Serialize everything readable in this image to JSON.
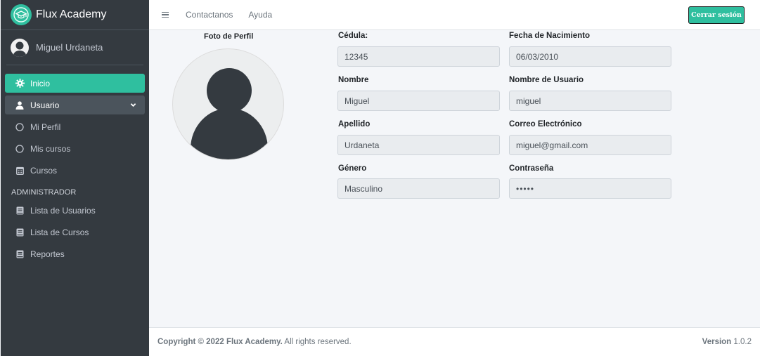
{
  "brand": {
    "name": "Flux Academy",
    "logo_icon": "graduation-cap-icon",
    "accent": "#2fbf9f"
  },
  "user": {
    "name": "Miguel Urdaneta"
  },
  "sidebar": {
    "items": [
      {
        "label": "Inicio",
        "icon": "gear-icon"
      },
      {
        "label": "Usuario",
        "icon": "user-icon"
      },
      {
        "label": "Mi Perfil",
        "icon": "circle-icon"
      },
      {
        "label": "Mis cursos",
        "icon": "circle-icon"
      },
      {
        "label": "Cursos",
        "icon": "calendar-icon"
      }
    ],
    "admin_header": "ADMINISTRADOR",
    "admin_items": [
      {
        "label": "Lista de Usuarios",
        "icon": "book-icon"
      },
      {
        "label": "Lista de Cursos",
        "icon": "book-icon"
      },
      {
        "label": "Reportes",
        "icon": "book-icon"
      }
    ]
  },
  "topbar": {
    "links": [
      "Contactanos",
      "Ayuda"
    ],
    "logout_label": "Cerrar sesión"
  },
  "profile": {
    "photo_label": "Foto de Perfil",
    "fields": {
      "cedula": {
        "label": "Cédula:",
        "value": "12345"
      },
      "fecha": {
        "label": "Fecha de Nacimiento",
        "value": "06/03/2010"
      },
      "nombre": {
        "label": "Nombre",
        "value": "Miguel"
      },
      "usuario": {
        "label": "Nombre de Usuario",
        "value": "miguel"
      },
      "apellido": {
        "label": "Apellido",
        "value": "Urdaneta"
      },
      "correo": {
        "label": "Correo Electrónico",
        "value": "miguel@gmail.com"
      },
      "genero": {
        "label": "Género",
        "value": "Masculino"
      },
      "contrasena": {
        "label": "Contraseña",
        "value": "•••••"
      }
    }
  },
  "footer": {
    "copyright_bold": "Copyright © 2022 Flux Academy.",
    "copyright_rest": " All rights reserved.",
    "version_label": "Version",
    "version_value": " 1.0.2"
  }
}
